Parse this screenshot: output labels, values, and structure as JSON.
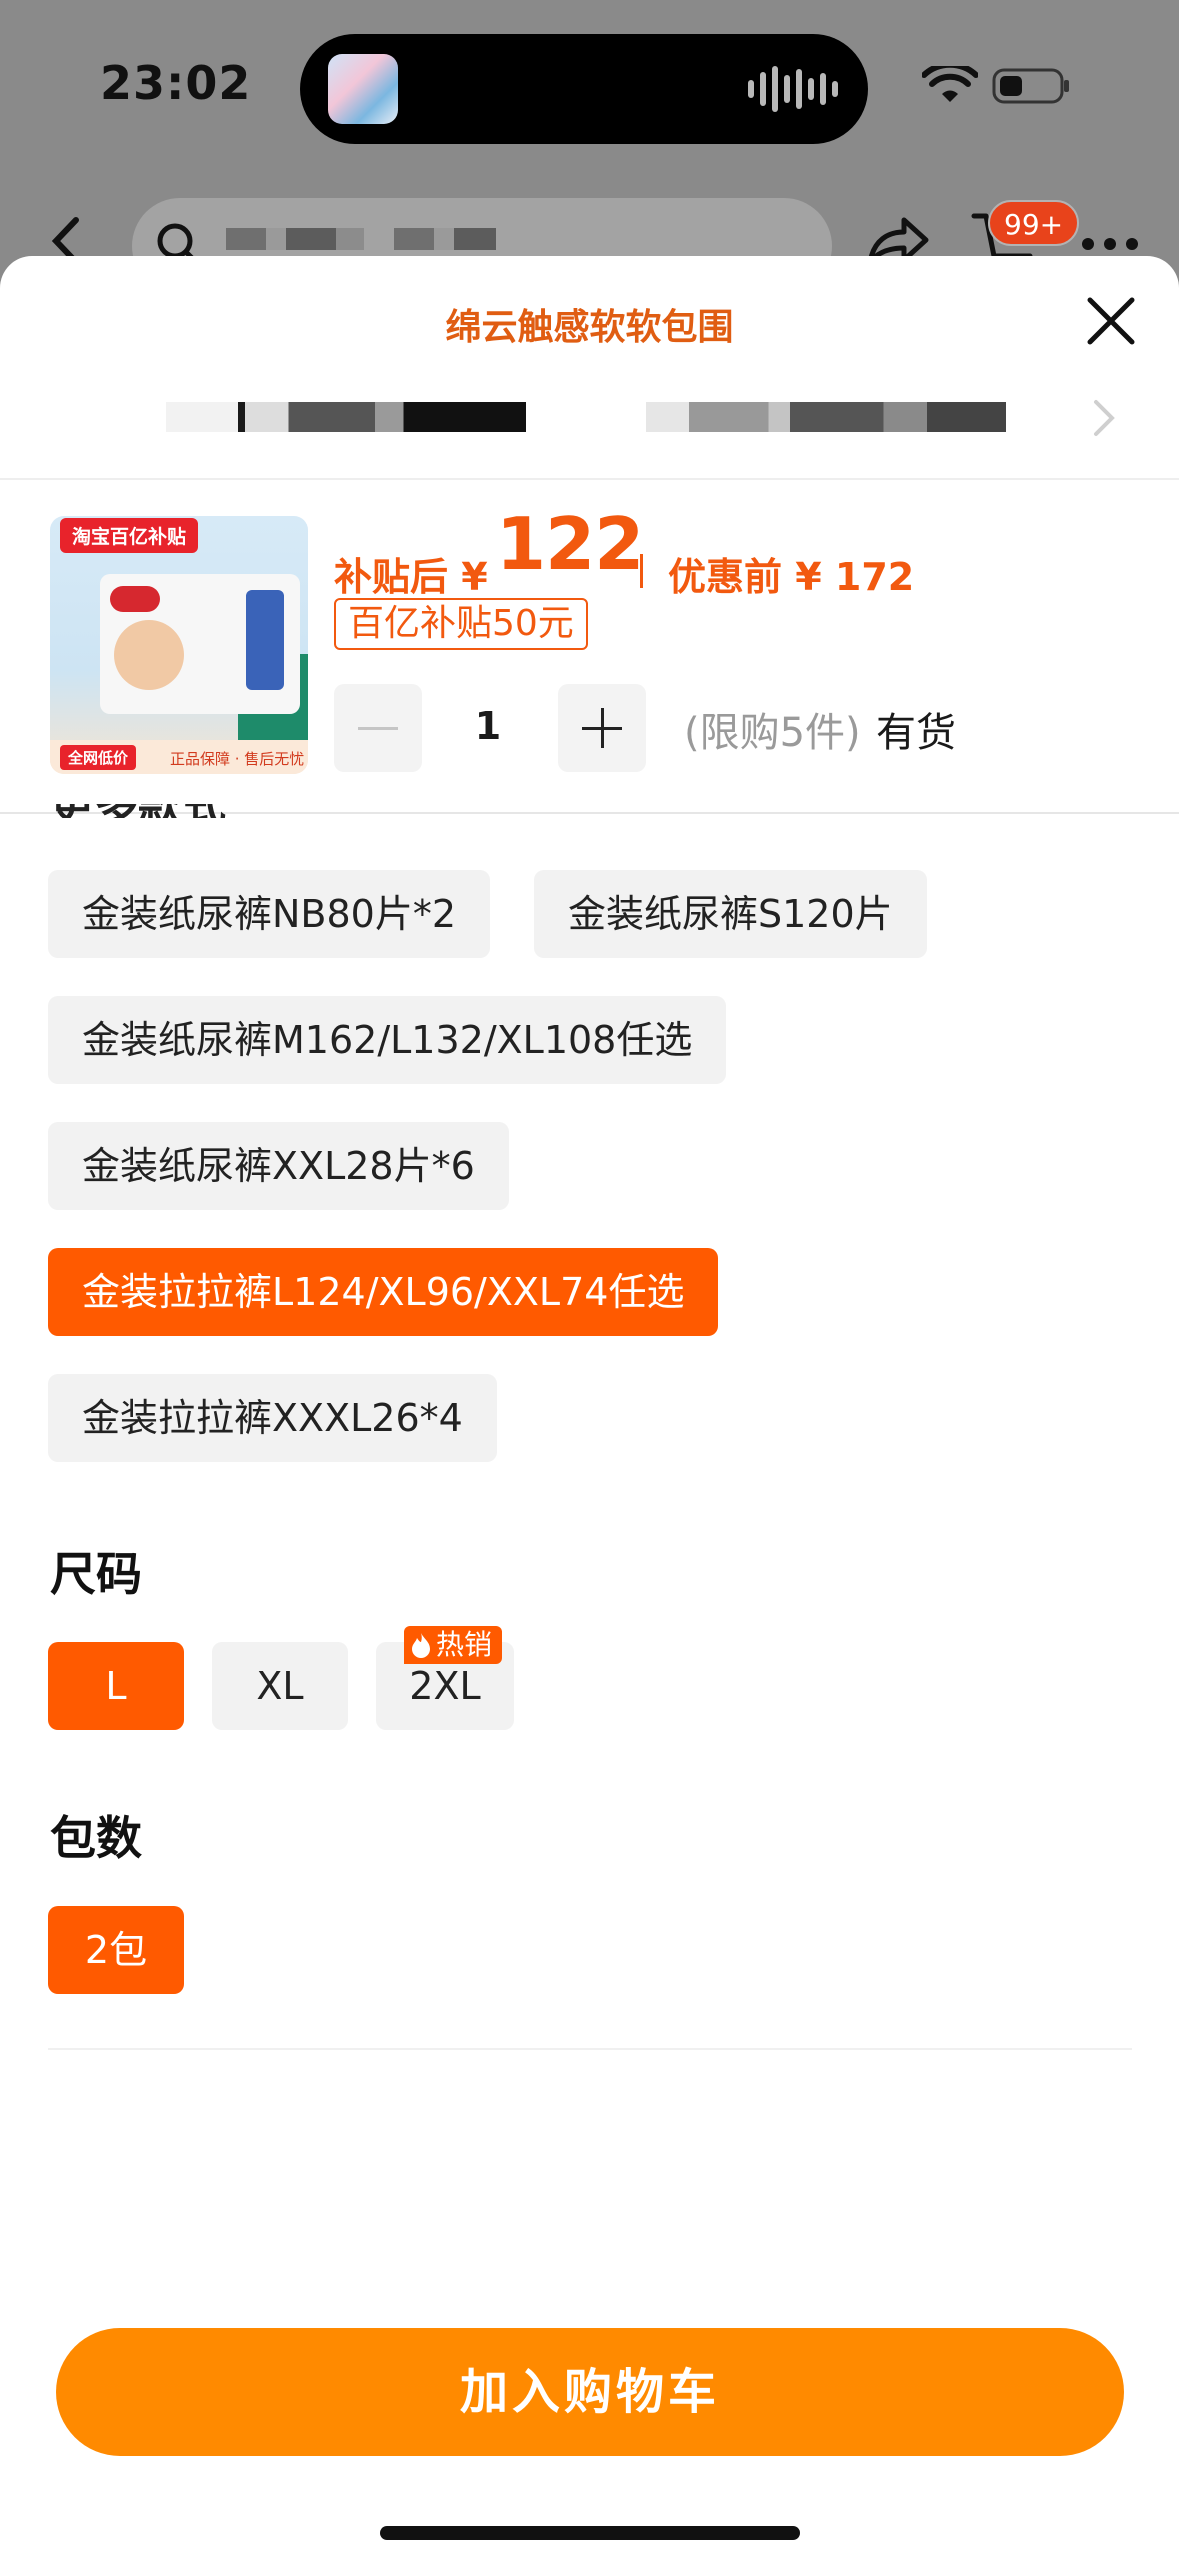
{
  "status_bar": {
    "time": "23:02"
  },
  "nav": {
    "cart_badge": "99+"
  },
  "sheet": {
    "title": "绵云触感软软包围",
    "price": {
      "after_label": "补贴后 ¥",
      "after_value": "122",
      "before": "优惠前 ¥ 172",
      "subsidy": "百亿补贴50元"
    },
    "thumb": {
      "tag": "淘宝百亿补贴",
      "chip": "全网低价",
      "note": "正品保障 · 售后无忧"
    },
    "quantity": {
      "value": "1",
      "limit": "(限购5件)",
      "stock": "有货"
    },
    "styles": [
      {
        "label": "金装纸尿裤NB80片*2",
        "selected": false
      },
      {
        "label": "金装纸尿裤S120片",
        "selected": false
      },
      {
        "label": "金装纸尿裤M162/L132/XL108任选",
        "selected": false
      },
      {
        "label": "金装纸尿裤XXL28片*6",
        "selected": false
      },
      {
        "label": "金装拉拉裤L124/XL96/XXL74任选",
        "selected": true
      },
      {
        "label": "金装拉拉裤XXXL26*4",
        "selected": false
      }
    ],
    "size": {
      "label": "尺码",
      "options": [
        "L",
        "XL",
        "2XL"
      ],
      "selected": "L",
      "hot_badge": "热销"
    },
    "packs": {
      "label": "包数",
      "options": [
        "2包"
      ],
      "selected": "2包"
    },
    "add_to_cart": "加入购物车"
  },
  "colors": {
    "accent": "#ff5a00",
    "price": "#f2590f",
    "button": "#ff8a00"
  }
}
